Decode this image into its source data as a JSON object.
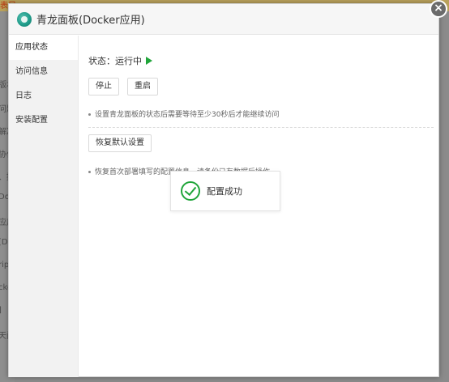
{
  "background": {
    "top_fragment": "表目",
    "side_fragments": [
      "版本",
      "问题",
      "解决",
      "协作",
      "、提",
      "Doc",
      "应用",
      "[D",
      "rip",
      "cke",
      "]",
      "天问"
    ]
  },
  "dialog": {
    "title": "青龙面板(Docker应用)",
    "close_glyph": "×"
  },
  "sidebar": {
    "items": [
      {
        "label": "应用状态",
        "active": true
      },
      {
        "label": "访问信息",
        "active": false
      },
      {
        "label": "日志",
        "active": false
      },
      {
        "label": "安装配置",
        "active": false
      }
    ]
  },
  "main": {
    "status_label": "状态：运行中",
    "stop_button": "停止",
    "restart_button": "重启",
    "tip_restart": "设置青龙面板的状态后需要等待至少30秒后才能继续访问",
    "restore_button": "恢复默认设置",
    "tip_restore": "恢复首次部署填写的配置信息，请备份已有数据后操作"
  },
  "toast": {
    "message": "配置成功"
  },
  "colors": {
    "accent_green": "#20a53a",
    "sidebar_bg": "#f2f2f2",
    "overlay": "#8b8b8b"
  }
}
